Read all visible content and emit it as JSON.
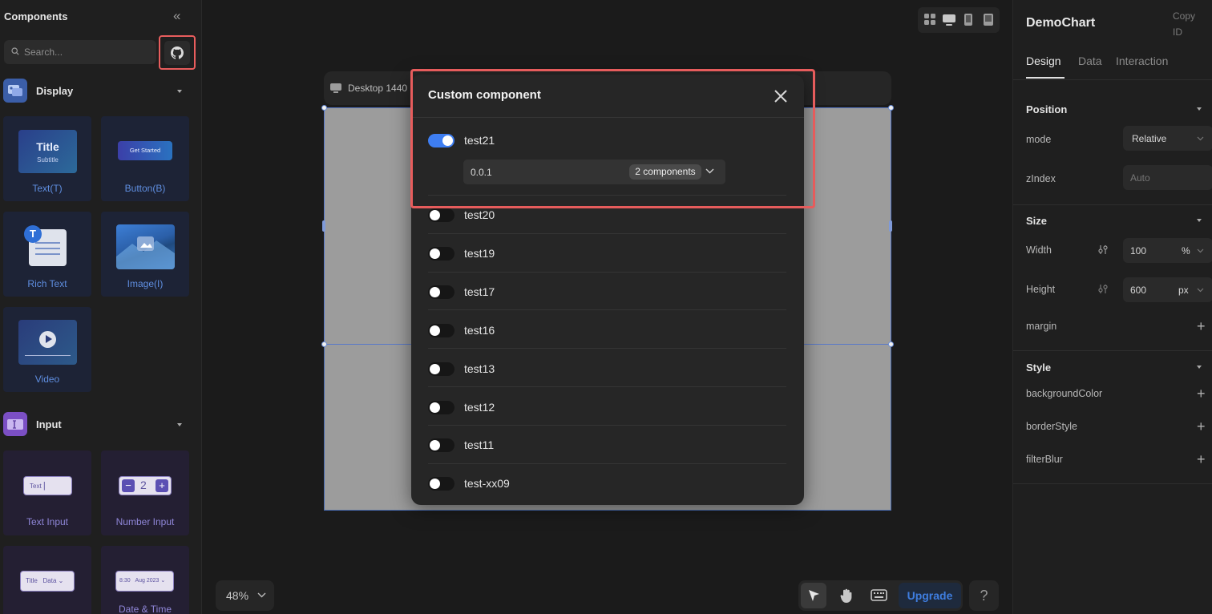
{
  "sidebar": {
    "title": "Components",
    "search_placeholder": "Search...",
    "categories": [
      {
        "label": "Display",
        "color": "#4a6fc8"
      },
      {
        "label": "Input",
        "color": "#7b4fc4"
      }
    ],
    "display_items": [
      {
        "label": "Text(T)",
        "preview_title": "Title",
        "preview_subtitle": "Subtitle"
      },
      {
        "label": "Button(B)",
        "preview_button": "Get Started"
      },
      {
        "label": "Rich Text",
        "badge": "T"
      },
      {
        "label": "Image(I)"
      },
      {
        "label": "Video"
      }
    ],
    "input_items": [
      {
        "label": "Text Input",
        "preview": "Text"
      },
      {
        "label": "Number Input",
        "preview_value": "2",
        "minus": "−",
        "plus": "+"
      },
      {
        "preview_a": "Title",
        "preview_b": "Data"
      },
      {
        "label": "Date & Time",
        "preview_time": "8:30",
        "preview_date": "Aug 2023"
      }
    ]
  },
  "canvas": {
    "frame_label": "Desktop 1440",
    "zoom": "48%",
    "upgrade_label": "Upgrade",
    "help": "?"
  },
  "modal": {
    "title": "Custom component",
    "expanded": {
      "name": "test21",
      "enabled": true,
      "version": "0.0.1",
      "components": "2 components"
    },
    "rows": [
      {
        "name": "test20",
        "enabled": false
      },
      {
        "name": "test19",
        "enabled": false
      },
      {
        "name": "test17",
        "enabled": false
      },
      {
        "name": "test16",
        "enabled": false
      },
      {
        "name": "test13",
        "enabled": false
      },
      {
        "name": "test12",
        "enabled": false
      },
      {
        "name": "test11",
        "enabled": false
      },
      {
        "name": "test-xx09",
        "enabled": false
      }
    ]
  },
  "inspector": {
    "title": "DemoChart",
    "copy_id": "Copy ID",
    "tabs": [
      "Design",
      "Data",
      "Interaction"
    ],
    "position": {
      "label": "Position",
      "mode_label": "mode",
      "mode_value": "Relative",
      "zindex_label": "zIndex",
      "zindex_placeholder": "Auto"
    },
    "size": {
      "label": "Size",
      "width_label": "Width",
      "width_value": "100",
      "width_unit": "%",
      "height_label": "Height",
      "height_value": "600",
      "height_unit": "px",
      "margin_label": "margin"
    },
    "style": {
      "label": "Style",
      "props": [
        "backgroundColor",
        "borderStyle",
        "filterBlur"
      ]
    }
  },
  "colors": {
    "accent": "#3e7ef2",
    "highlight": "#e65c5c"
  }
}
